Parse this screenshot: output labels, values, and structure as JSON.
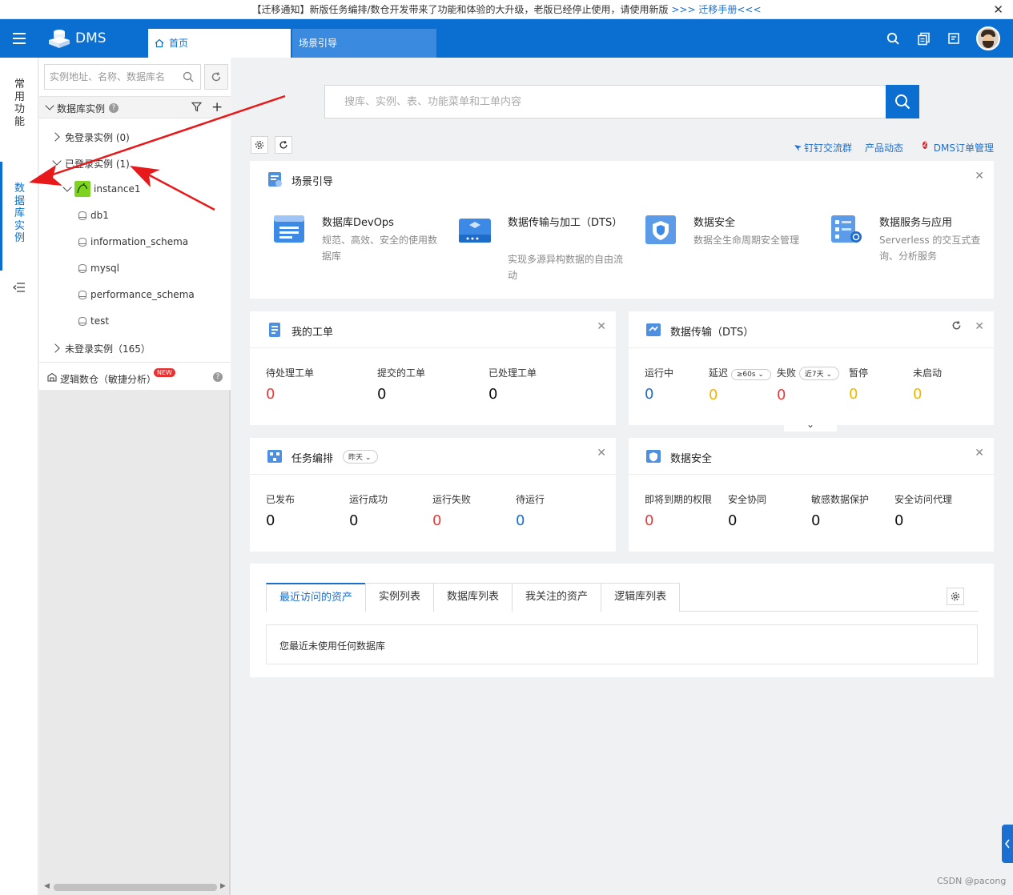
{
  "notice": {
    "text": "【迁移通知】新版任务编排/数仓开发带来了功能和体验的大升级，老版已经停止使用，请使用新版",
    "link": ">>> 迁移手册<<<"
  },
  "header": {
    "app_name": "DMS",
    "tabs": [
      {
        "label": "首页",
        "active": true
      },
      {
        "label": "场景引导",
        "active": false
      }
    ]
  },
  "rail": {
    "items": [
      {
        "label": "常用功能",
        "active": false
      },
      {
        "label": "数据库实例",
        "active": true
      }
    ]
  },
  "sidebar": {
    "search_placeholder": "实例地址、名称、数据库名",
    "section_title": "数据库实例",
    "nodes": [
      {
        "label": "免登录实例 (0)",
        "expanded": false
      },
      {
        "label": "已登录实例 (1)",
        "expanded": true
      },
      {
        "label": "instance1",
        "expanded": true
      },
      {
        "label": "db1"
      },
      {
        "label": "information_schema"
      },
      {
        "label": "mysql"
      },
      {
        "label": "performance_schema"
      },
      {
        "label": "test"
      },
      {
        "label": "未登录实例（165）",
        "expanded": false
      }
    ],
    "logic_label": "逻辑数仓（敏捷分析）",
    "new_badge": "NEW"
  },
  "main": {
    "search_placeholder": "搜库、实例、表、功能菜单和工单内容",
    "links": [
      "钉钉交流群",
      "产品动态",
      "DMS订单管理"
    ],
    "product_badge": "2",
    "guide": {
      "title": "场景引导",
      "items": [
        {
          "title": "数据库DevOps",
          "desc": "规范、高效、安全的使用数据库"
        },
        {
          "title": "数据传输与加工（DTS）",
          "desc": "实现多源异构数据的自由流动"
        },
        {
          "title": "数据安全",
          "desc": "数据全生命周期安全管理"
        },
        {
          "title": "数据服务与应用",
          "desc": "Serverless 的交互式查询、分析服务"
        }
      ]
    },
    "tickets": {
      "title": "我的工单",
      "stats": [
        {
          "label": "待处理工单",
          "value": "0"
        },
        {
          "label": "提交的工单",
          "value": "0"
        },
        {
          "label": "已处理工单",
          "value": "0"
        }
      ]
    },
    "dts": {
      "title": "数据传输（DTS）",
      "stats": [
        {
          "label": "运行中",
          "value": "0"
        },
        {
          "label": "延迟",
          "value": "0"
        },
        {
          "label": "失败",
          "value": "0"
        },
        {
          "label": "暂停",
          "value": "0"
        },
        {
          "label": "未启动",
          "value": "0"
        }
      ],
      "delay_select": "≥60s",
      "fail_select": "近7天"
    },
    "tasks": {
      "title": "任务编排",
      "period_select": "昨天",
      "stats": [
        {
          "label": "已发布",
          "value": "0"
        },
        {
          "label": "运行成功",
          "value": "0"
        },
        {
          "label": "运行失败",
          "value": "0"
        },
        {
          "label": "待运行",
          "value": "0"
        }
      ]
    },
    "security": {
      "title": "数据安全",
      "stats": [
        {
          "label": "即将到期的权限",
          "value": "0"
        },
        {
          "label": "安全协同",
          "value": "0"
        },
        {
          "label": "敏感数据保护",
          "value": "0"
        },
        {
          "label": "安全访问代理",
          "value": "0"
        }
      ]
    },
    "assets": {
      "tabs": [
        "最近访问的资产",
        "实例列表",
        "数据库列表",
        "我关注的资产",
        "逻辑库列表"
      ],
      "empty_text": "您最近未使用任何数据库"
    }
  },
  "watermark": "CSDN @pacong",
  "colors": {
    "brand": "#0a6fd0",
    "danger": "#e83a3a",
    "warning": "#f5b400"
  }
}
